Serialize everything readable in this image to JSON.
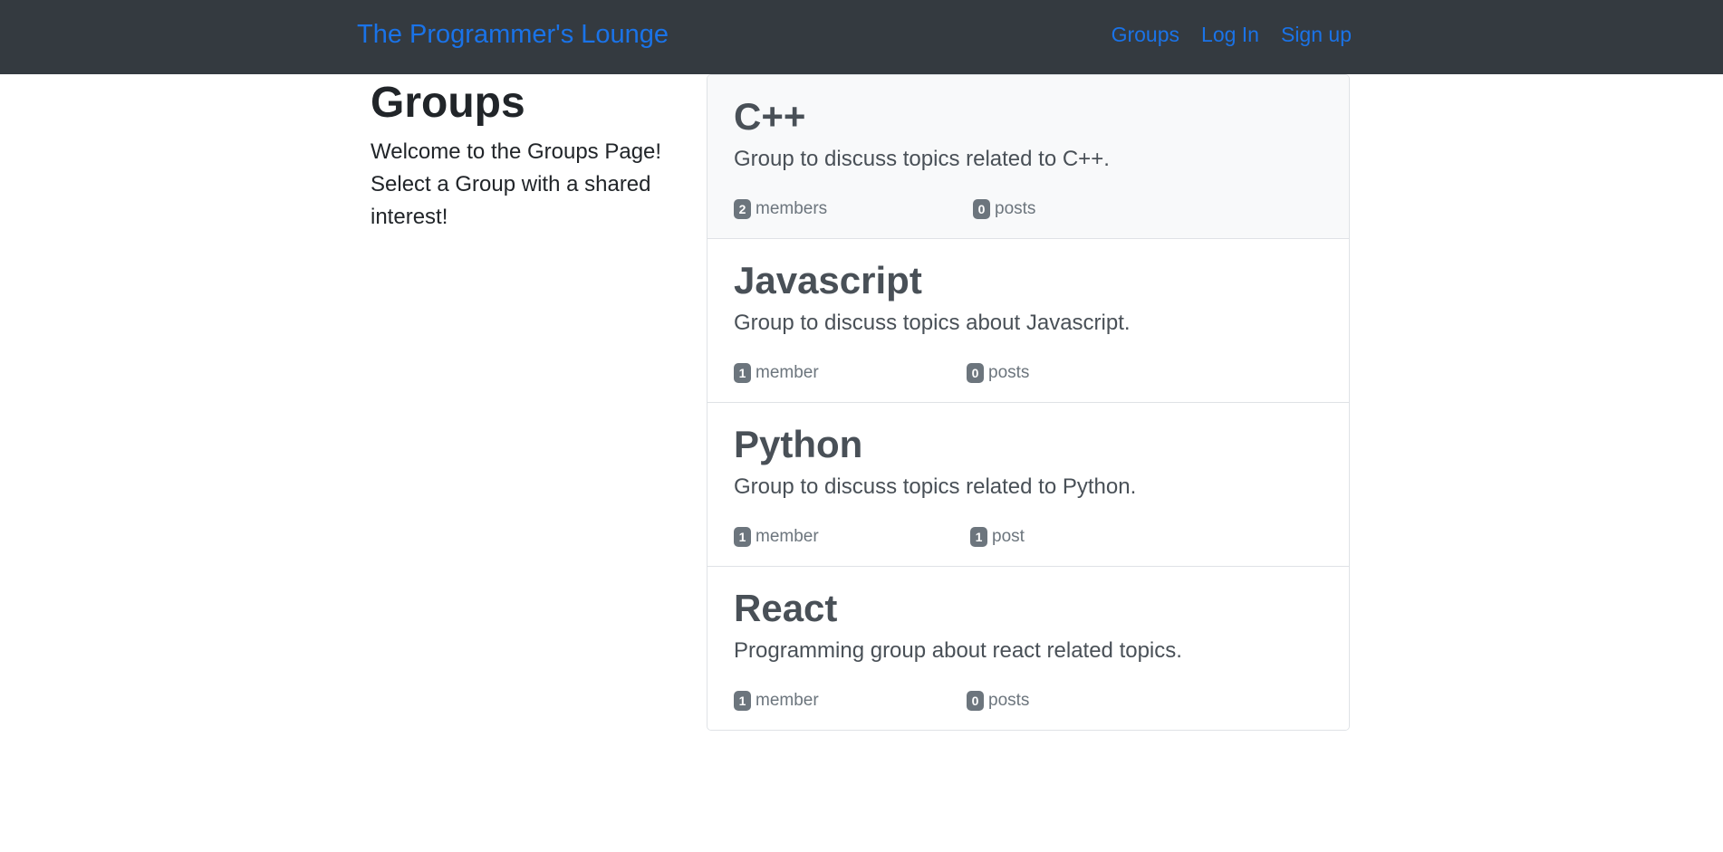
{
  "nav": {
    "brand": "The Programmer's Lounge",
    "links": [
      "Groups",
      "Log In",
      "Sign up"
    ]
  },
  "sidebar": {
    "title": "Groups",
    "welcome": "Welcome to the Groups Page! Select a Group with a shared interest!"
  },
  "groups": [
    {
      "name": "C++",
      "description": "Group to discuss topics related to C++.",
      "member_count": "2",
      "member_label": "members",
      "post_count": "0",
      "post_label": "posts"
    },
    {
      "name": "Javascript",
      "description": "Group to discuss topics about Javascript.",
      "member_count": "1",
      "member_label": "member",
      "post_count": "0",
      "post_label": "posts"
    },
    {
      "name": "Python",
      "description": "Group to discuss topics related to Python.",
      "member_count": "1",
      "member_label": "member",
      "post_count": "1",
      "post_label": "post"
    },
    {
      "name": "React",
      "description": "Programming group about react related topics.",
      "member_count": "1",
      "member_label": "member",
      "post_count": "0",
      "post_label": "posts"
    }
  ],
  "colors": {
    "navbar_bg": "#343a40",
    "link": "#1a73e8",
    "badge_bg": "#6c757d",
    "active_item_bg": "#f8f9fa"
  }
}
